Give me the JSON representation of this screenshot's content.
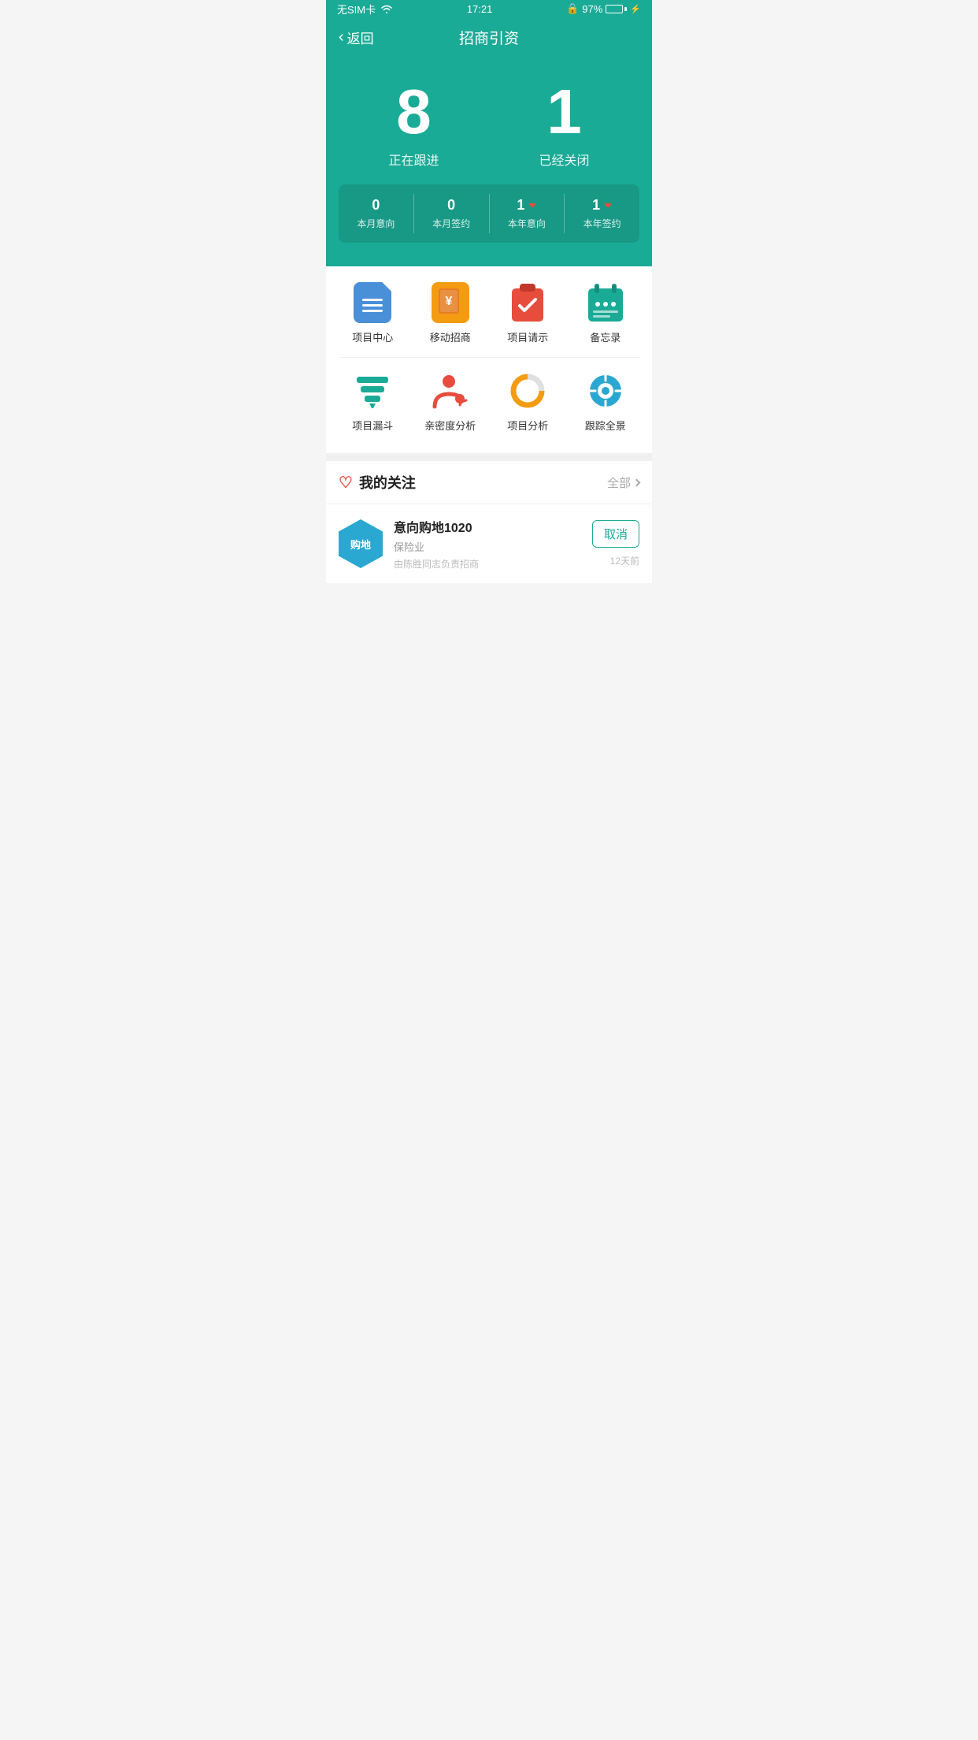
{
  "statusBar": {
    "left": "无SIM卡  ☆",
    "time": "17:21",
    "battery": "97%"
  },
  "navBar": {
    "backLabel": "返回",
    "title": "招商引资"
  },
  "heroStats": {
    "followingCount": "8",
    "followingLabel": "正在跟进",
    "closedCount": "1",
    "closedLabel": "已经关闭"
  },
  "subStats": [
    {
      "value": "0",
      "label": "本月意向",
      "arrow": false
    },
    {
      "value": "0",
      "label": "本月签约",
      "arrow": false
    },
    {
      "value": "1",
      "label": "本年意向",
      "arrow": true
    },
    {
      "value": "1",
      "label": "本年签约",
      "arrow": true
    }
  ],
  "menuRow1": [
    {
      "id": "project-center",
      "label": "项目中心"
    },
    {
      "id": "mobile-invest",
      "label": "移动招商"
    },
    {
      "id": "project-request",
      "label": "项目请示"
    },
    {
      "id": "memo",
      "label": "备忘录"
    }
  ],
  "menuRow2": [
    {
      "id": "funnel",
      "label": "项目漏斗"
    },
    {
      "id": "relation",
      "label": "亲密度分析"
    },
    {
      "id": "analysis",
      "label": "项目分析"
    },
    {
      "id": "tracking",
      "label": "跟踪全景"
    }
  ],
  "followsSection": {
    "title": "我的关注",
    "allLabel": "全部"
  },
  "followItems": [
    {
      "hexLabel": "购地",
      "name": "意向购地1020",
      "industry": "保险业",
      "manager": "由陈胜同志负责招商",
      "time": "12天前",
      "cancelLabel": "取消"
    }
  ],
  "colors": {
    "teal": "#1aab96",
    "orange": "#f39c12",
    "red": "#e74c3c",
    "blue": "#4a90d9",
    "hexBlue": "#2aa8d2"
  }
}
